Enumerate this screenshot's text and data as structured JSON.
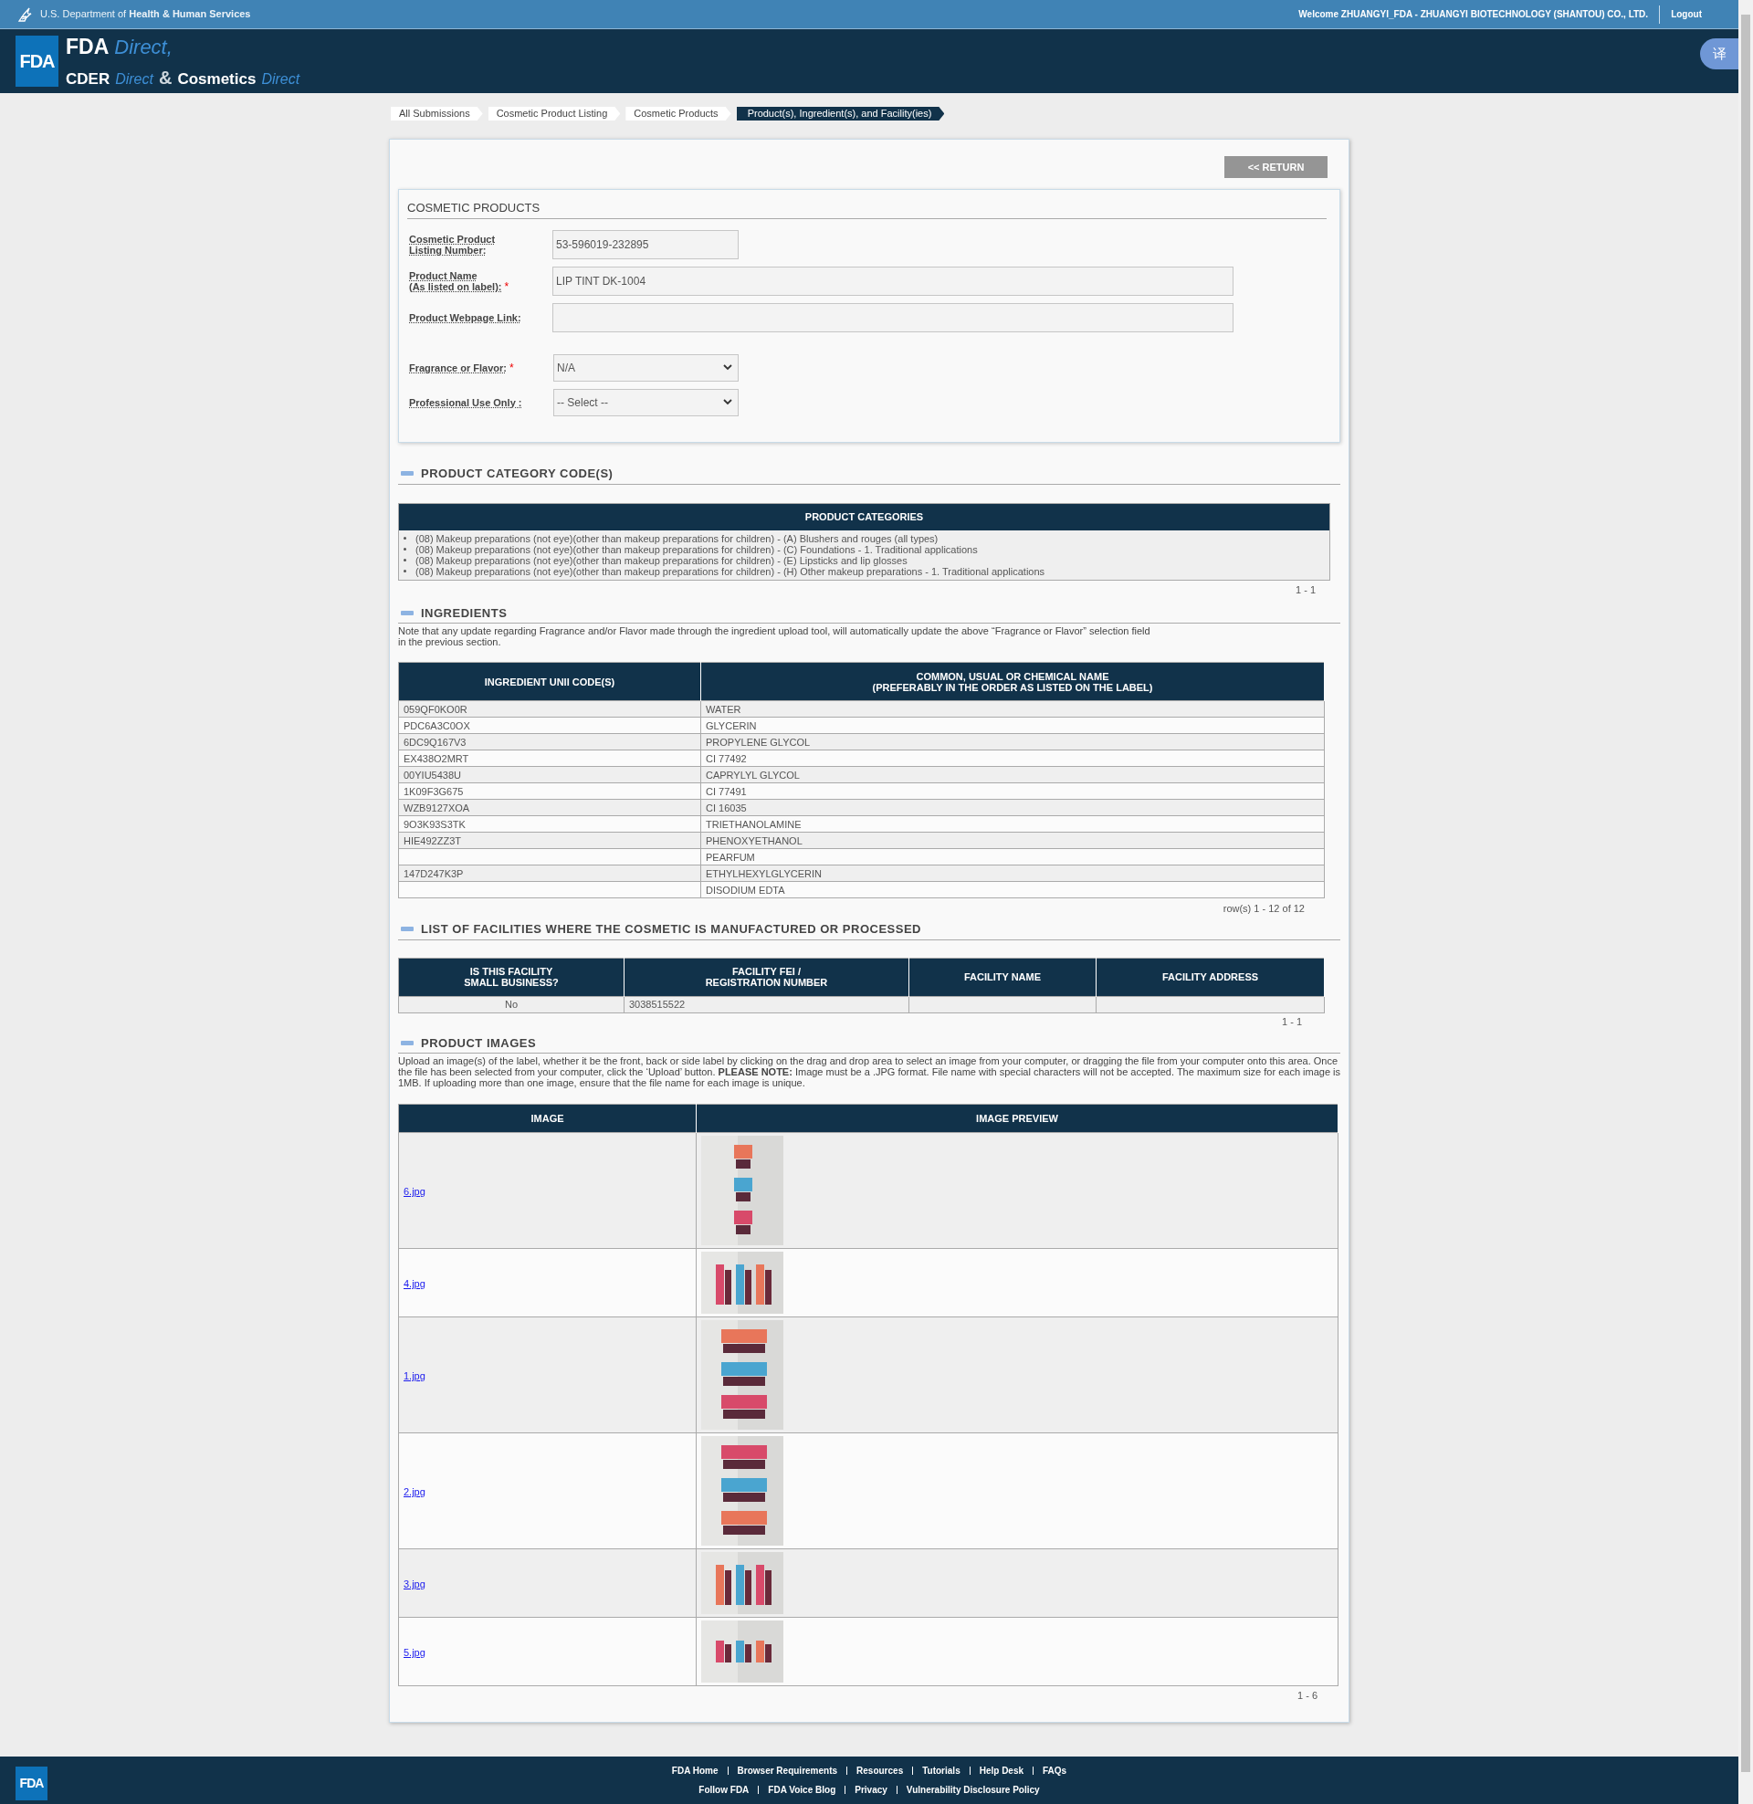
{
  "top_bar": {
    "agency": "U.S. Department of **Health & Human Services**",
    "welcome": "Welcome ZHUANGYI_FDA - ZHUANGYI BIOTECHNOLOGY (SHANTOU) CO., LTD.",
    "logout": "Logout"
  },
  "header": {
    "logo": "FDA",
    "line_1": [
      {
        "text": "FDA",
        "kind": "bold"
      },
      {
        "text": "Direct,",
        "kind": "accent"
      }
    ],
    "line_2": [
      {
        "text": "CDER",
        "kind": "bold"
      },
      {
        "text": "Direct",
        "kind": "accent"
      },
      {
        "text": "&",
        "kind": "amp"
      },
      {
        "text": "Cosmetics",
        "kind": "bold"
      },
      {
        "text": "Direct",
        "kind": "accent"
      }
    ],
    "translate_button": "译"
  },
  "breadcrumbs": [
    {
      "label": "All Submissions",
      "selected": false
    },
    {
      "label": "Cosmetic Product Listing",
      "selected": false
    },
    {
      "label": "Cosmetic Products",
      "selected": false
    },
    {
      "label": "Product(s), Ingredient(s), and Facility(ies)",
      "selected": true
    }
  ],
  "return_button": "<< RETURN",
  "cosmetic_products": {
    "title": "COSMETIC PRODUCTS",
    "fields": [
      {
        "label": "Cosmetic Product\nListing Number:",
        "kind": "number",
        "value": "53-596019-232895"
      },
      {
        "label": "Product Name\n(As listed on label):",
        "required_mark": "*",
        "kind": "text",
        "value": "LIP TINT DK-1004"
      },
      {
        "label": "Product Webpage Link:",
        "kind": "text"
      },
      {
        "label": "Fragrance or Flavor:",
        "required_mark": "*",
        "kind": "select",
        "value": "N/A"
      },
      {
        "label": "Professional Use Only :",
        "kind": "select",
        "value": "-- Select --"
      }
    ]
  },
  "product_categories": {
    "title": "PRODUCT CATEGORY CODE(S)",
    "header": "PRODUCT CATEGORIES",
    "items": [
      "(08) Makeup preparations (not eye)(other than makeup preparations for children) - (A) Blushers and rouges (all types)",
      "(08) Makeup preparations (not eye)(other than makeup preparations for children) - (C) Foundations - 1. Traditional applications",
      "(08) Makeup preparations (not eye)(other than makeup preparations for children) - (E) Lipsticks and lip glosses",
      "(08) Makeup preparations (not eye)(other than makeup preparations for children) - (H) Other makeup preparations - 1. Traditional applications"
    ],
    "pager": "1 - 1"
  },
  "ingredients": {
    "title": "INGREDIENTS",
    "note": "Note that any update regarding Fragrance and/or Flavor made through the ingredient upload tool, will automatically update the above “Fragrance or Flavor” selection field\nin the previous section.",
    "columns": [
      "INGREDIENT UNII CODE(S)",
      "COMMON, USUAL OR CHEMICAL NAME\n(PREFERABLY IN THE ORDER AS LISTED ON THE LABEL)"
    ],
    "rows": [
      [
        "059QF0KO0R",
        "WATER"
      ],
      [
        "PDC6A3C0OX",
        "GLYCERIN"
      ],
      [
        "6DC9Q167V3",
        "PROPYLENE GLYCOL"
      ],
      [
        "EX438O2MRT",
        "CI 77492"
      ],
      [
        "00YIU5438U",
        "CAPRYLYL GLYCOL"
      ],
      [
        "1K09F3G675",
        "CI 77491"
      ],
      [
        "WZB9127XOA",
        "CI 16035"
      ],
      [
        "9O3K93S3TK",
        "TRIETHANOLAMINE"
      ],
      [
        "HIE492ZZ3T",
        "PHENOXYETHANOL"
      ],
      [
        null,
        "PEARFUM"
      ],
      [
        "147D247K3P",
        "ETHYLHEXYLGLYCERIN"
      ],
      [
        null,
        "DISODIUM EDTA"
      ]
    ],
    "pager": "row(s) 1 - 12 of 12"
  },
  "facilities": {
    "title": "LIST OF FACILITIES WHERE THE COSMETIC IS MANUFACTURED OR PROCESSED",
    "columns": [
      "IS THIS FACILITY\nSMALL BUSINESS?",
      "FACILITY FEI /\nREGISTRATION NUMBER",
      "FACILITY NAME",
      "FACILITY ADDRESS"
    ],
    "rows": [
      [
        "No",
        "3038515522",
        null,
        null
      ]
    ],
    "pager": "1 - 1"
  },
  "product_images": {
    "title": "PRODUCT IMAGES",
    "note": "Upload an image(s) of the label, whether it be the front, back or side label by clicking on the drag and drop area to select an image from your computer, or dragging the file from your computer onto this area. Once the file has been selected from your computer, click the ‘Upload’ button. **PLEASE NOTE:** Image must be a .JPG format. File name with special characters will not be accepted. The maximum size for each image is 1MB. If uploading more than one image, ensure that the file name for each image is unique.",
    "columns": [
      "IMAGE",
      "IMAGE PREVIEW"
    ],
    "rows": [
      {
        "file": "6.jpg"
      },
      {
        "file": "4.jpg"
      },
      {
        "file": "1.jpg"
      },
      {
        "file": "2.jpg"
      },
      {
        "file": "3.jpg"
      },
      {
        "file": "5.jpg"
      }
    ],
    "pager": "1 - 6"
  },
  "footer": {
    "logo": "FDA",
    "links_1": [
      "FDA Home",
      "Browser Requirements",
      "Resources",
      "Tutorials",
      "Help Desk",
      "FAQs"
    ],
    "links_2": [
      "Follow FDA",
      "FDA Voice Blog",
      "Privacy",
      "Vulnerability Disclosure Policy"
    ]
  }
}
